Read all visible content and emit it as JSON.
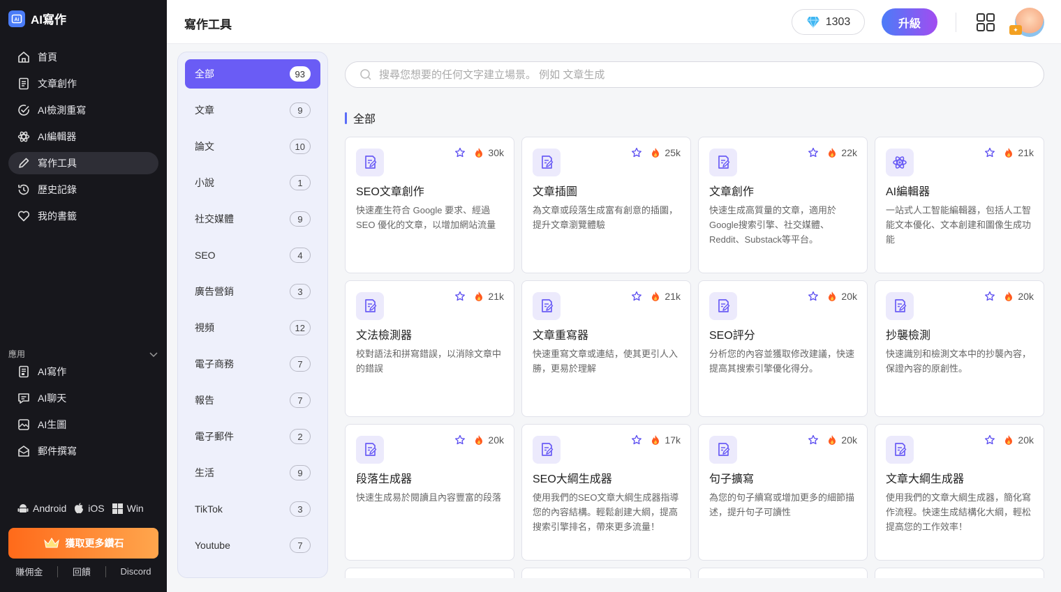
{
  "app": {
    "logo_text": "AI寫作",
    "logo_icon": "ai-logo-icon"
  },
  "sidebar": {
    "nav": [
      {
        "label": "首頁",
        "icon": "home-icon"
      },
      {
        "label": "文章創作",
        "icon": "document-icon"
      },
      {
        "label": "AI檢測重寫",
        "icon": "check-circle-icon"
      },
      {
        "label": "AI編輯器",
        "icon": "atom-icon"
      },
      {
        "label": "寫作工具",
        "icon": "pen-icon",
        "active": true
      },
      {
        "label": "歷史記錄",
        "icon": "history-icon"
      },
      {
        "label": "我的書籤",
        "icon": "heart-icon"
      }
    ],
    "apps_label": "應用",
    "apps": [
      {
        "label": "AI寫作",
        "icon": "doc-app-icon"
      },
      {
        "label": "AI聊天",
        "icon": "chat-icon"
      },
      {
        "label": "AI生圖",
        "icon": "image-icon"
      },
      {
        "label": "郵件撰寫",
        "icon": "mail-icon"
      }
    ],
    "platforms": [
      "Android",
      "iOS",
      "Win"
    ],
    "get_diamonds": "獲取更多鑽石",
    "footer_links": [
      "賺佣金",
      "回饋",
      "Discord"
    ]
  },
  "header": {
    "title": "寫作工具",
    "diamonds": "1303",
    "upgrade": "升級"
  },
  "categories": [
    {
      "label": "全部",
      "count": "93",
      "active": true
    },
    {
      "label": "文章",
      "count": "9"
    },
    {
      "label": "論文",
      "count": "10"
    },
    {
      "label": "小說",
      "count": "1"
    },
    {
      "label": "社交媒體",
      "count": "9"
    },
    {
      "label": "SEO",
      "count": "4"
    },
    {
      "label": "廣告營銷",
      "count": "3"
    },
    {
      "label": "視頻",
      "count": "12"
    },
    {
      "label": "電子商務",
      "count": "7"
    },
    {
      "label": "報告",
      "count": "7"
    },
    {
      "label": "電子郵件",
      "count": "2"
    },
    {
      "label": "生活",
      "count": "9"
    },
    {
      "label": "TikTok",
      "count": "3"
    },
    {
      "label": "Youtube",
      "count": "7"
    }
  ],
  "search": {
    "placeholder": "搜尋您想要的任何文字建立場景。 例如 文章生成"
  },
  "section_title": "全部",
  "tools": [
    {
      "title": "SEO文章創作",
      "views": "30k",
      "icon": "edit-doc-icon",
      "desc": "快速產生符合 Google 要求、經過 SEO 優化的文章，以增加網站流量"
    },
    {
      "title": "文章插圖",
      "views": "25k",
      "icon": "edit-doc-icon",
      "desc": "為文章或段落生成富有創意的插圖，提升文章瀏覽體驗"
    },
    {
      "title": "文章創作",
      "views": "22k",
      "icon": "edit-doc-icon",
      "desc": "快速生成高質量的文章，適用於Google搜索引擎、社交媒體、Reddit、Substack等平台。"
    },
    {
      "title": "AI編輯器",
      "views": "21k",
      "icon": "atom-icon",
      "desc": "一站式人工智能編輯器，包括人工智能文本優化、文本創建和圖像生成功能"
    },
    {
      "title": "文法檢測器",
      "views": "21k",
      "icon": "edit-doc-icon",
      "desc": "校對語法和拼寫錯誤，以消除文章中的錯誤"
    },
    {
      "title": "文章重寫器",
      "views": "21k",
      "icon": "edit-doc-icon",
      "desc": "快速重寫文章或連結，使其更引人入勝，更易於理解"
    },
    {
      "title": "SEO評分",
      "views": "20k",
      "icon": "edit-doc-icon",
      "desc": "分析您的內容並獲取修改建議，快速提高其搜索引擎優化得分。"
    },
    {
      "title": "抄襲檢測",
      "views": "20k",
      "icon": "edit-doc-icon",
      "desc": "快速識別和檢測文本中的抄襲內容，保證內容的原創性。"
    },
    {
      "title": "段落生成器",
      "views": "20k",
      "icon": "edit-doc-icon",
      "desc": "快速生成易於閱讀且內容豐富的段落"
    },
    {
      "title": "SEO大綱生成器",
      "views": "17k",
      "icon": "edit-doc-icon",
      "desc": "使用我們的SEO文章大綱生成器指導您的內容結構。輕鬆創建大綱，提高搜索引擎排名，帶來更多流量！"
    },
    {
      "title": "句子擴寫",
      "views": "20k",
      "icon": "edit-doc-icon",
      "desc": "為您的句子續寫或增加更多的細節描述，提升句子可讀性"
    },
    {
      "title": "文章大綱生成器",
      "views": "20k",
      "icon": "edit-doc-icon",
      "desc": "使用我們的文章大綱生成器，簡化寫作流程。快速生成結構化大綱，輕松提高您的工作效率！"
    }
  ],
  "colors": {
    "sidebar_bg": "#17171c",
    "accent": "#6a5cf5",
    "orange": "#ff7a1f",
    "fire": "#ff5a1f",
    "star": "#5a4cf0"
  }
}
